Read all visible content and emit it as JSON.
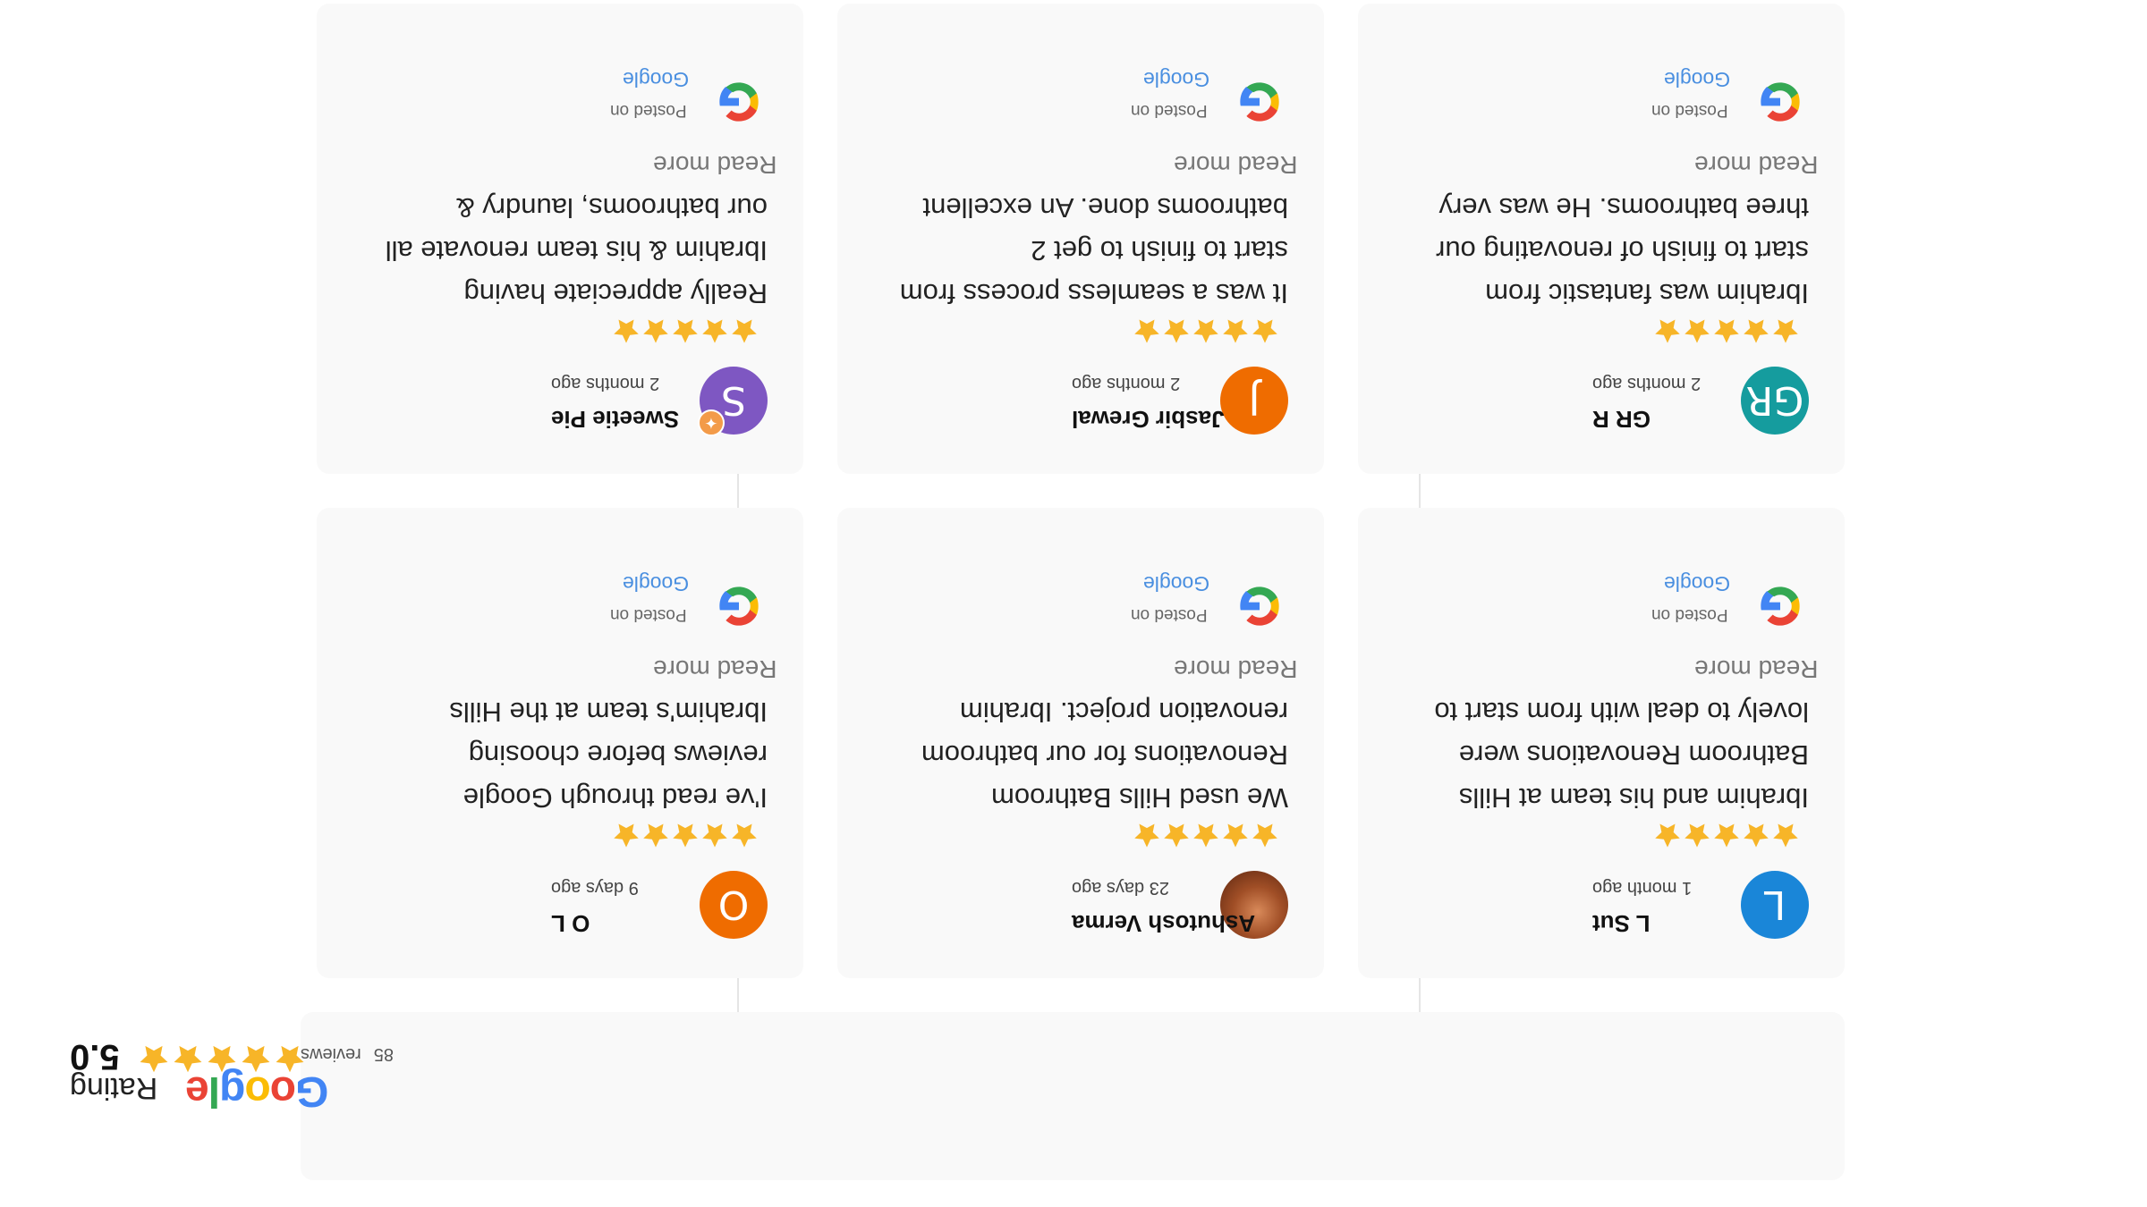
{
  "summary": {
    "logo_letters": [
      "G",
      "o",
      "o",
      "g",
      "l",
      "e"
    ],
    "logo_colors": [
      "#4285F4",
      "#EA4335",
      "#FBBC05",
      "#4285F4",
      "#34A853",
      "#EA4335"
    ],
    "rating_label": "Rating",
    "score": "5.0",
    "stars": 5,
    "review_count": "85",
    "reviews_label": "reviews"
  },
  "colors": {
    "star": "#F7B528",
    "source_link": "#4A8FE0",
    "card_bg": "#F9F9F9"
  },
  "reviews": [
    {
      "name": "L Sut",
      "time": "1 month ago",
      "avatar_letter": "L",
      "avatar_color": "#1A86D8",
      "rating": 5,
      "text_lines": [
        "Ibrahim and his team at Hills",
        "Bathroom Renovations were",
        "lovely to deal with from start to"
      ],
      "read_more": "Read more",
      "posted_on": "Posted on",
      "source": "Google",
      "source_icon": "google-g-icon"
    },
    {
      "name": "Ashutosh Verma",
      "time": "23 days ago",
      "avatar_letter": "",
      "avatar_color": "#8A3B1E",
      "rating": 5,
      "text_lines": [
        "We used Hills Bathroom",
        "Renovations for our bathroom",
        "renovation project. Ibrahim"
      ],
      "read_more": "Read more",
      "posted_on": "Posted on",
      "source": "Google",
      "source_icon": "google-g-icon"
    },
    {
      "name": "O L",
      "time": "9 days ago",
      "avatar_letter": "O",
      "avatar_color": "#EF6C00",
      "rating": 5,
      "text_lines": [
        "I've read through Google",
        "reviews before choosing",
        "Ibrahim's team at the Hills"
      ],
      "read_more": "Read more",
      "posted_on": "Posted on",
      "source": "Google",
      "source_icon": "google-g-icon"
    },
    {
      "name": "GR R",
      "time": "2 months ago",
      "avatar_letter": "GR",
      "avatar_color": "#159C9E",
      "rating": 5,
      "text_lines": [
        "Ibrahim was fantastic from",
        "start to finish of renovating our",
        "three bathrooms. He was very"
      ],
      "read_more": "Read more",
      "posted_on": "Posted on",
      "source": "Google",
      "source_icon": "google-g-icon"
    },
    {
      "name": "Jasbir Grewal",
      "time": "2 months ago",
      "avatar_letter": "J",
      "avatar_color": "#EF6C00",
      "rating": 5,
      "text_lines": [
        "It was a seamless process from",
        "start to finish to get 2",
        "bathrooms done. An excellent"
      ],
      "read_more": "Read more",
      "posted_on": "Posted on",
      "source": "Google",
      "source_icon": "google-g-icon"
    },
    {
      "name": "Sweetie Pie",
      "time": "2 months ago",
      "avatar_letter": "S",
      "avatar_color": "#7E57C2",
      "rating": 5,
      "text_lines": [
        "Really appreciate having",
        "Ibrahim & his team renovate all",
        "our bathrooms, laundry &"
      ],
      "read_more": "Read more",
      "posted_on": "Posted on",
      "source": "Google",
      "source_icon": "google-g-icon"
    }
  ]
}
